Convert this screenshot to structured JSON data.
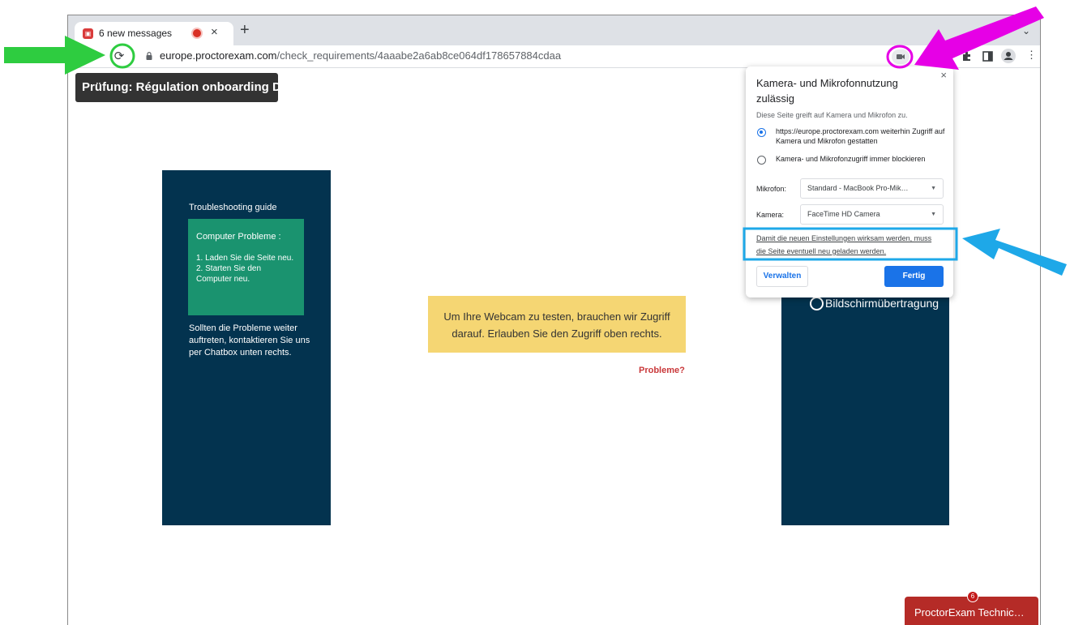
{
  "browser": {
    "tab": {
      "title": "6 new messages",
      "close_glyph": "×"
    },
    "new_tab_glyph": "+",
    "chevron_glyph": "⌄",
    "reload_glyph": "⟳",
    "url_host": "europe.proctorexam.com",
    "url_path": "/check_requirements/4aaabe2a6ab8ce064df178657884cdaa",
    "toolbar_icons": [
      "camera-in-use-icon",
      "extensions-icon",
      "side-panel-icon",
      "profile-icon",
      "menu-icon"
    ],
    "menu_glyph": "⋮"
  },
  "page": {
    "exam_title": "Prüfung: Régulation onboarding DE",
    "troubleshooting": {
      "heading": "Troubleshooting guide",
      "box_title": "Computer Probleme :",
      "box_text": "1. Laden Sie die Seite neu.\n2. Starten Sie den Computer neu.",
      "body": "Sollten die Probleme weiter auftreten, kontaktieren Sie uns per Chatbox unten rechts."
    },
    "webcam_notice": "Um Ihre Webcam zu testen, brauchen wir Zugriff darauf. Erlauben Sie den Zugriff oben rechts.",
    "problems_link": "Probleme?",
    "screen_share_label": "Bildschirmübertragung",
    "chat": {
      "label": "ProctorExam Technic…",
      "badge": "6"
    }
  },
  "popup": {
    "close_glyph": "×",
    "title": "Kamera- und Mikrofonnutzung zulässig",
    "description": "Diese Seite greift auf Kamera und Mikrofon zu.",
    "option_allow": "https://europe.proctorexam.com weiterhin Zugriff auf Kamera und Mikrofon gestatten",
    "option_block": "Kamera- und Mikrofonzugriff immer blockieren",
    "mic_label": "Mikrofon:",
    "mic_value": "Standard - MacBook Pro-Mik…",
    "cam_label": "Kamera:",
    "cam_value": "FaceTime HD Camera",
    "reload_notice": "Damit die neuen Einstellungen wirksam werden, muss die Seite eventuell neu geladen werden.",
    "manage_button": "Verwalten",
    "done_button": "Fertig",
    "caret_glyph": "▼",
    "selected_option": "allow"
  },
  "colors": {
    "panel_navy": "#03334f",
    "green_box": "#1a936f",
    "yellow_box": "#f5d673",
    "problems_red": "#c9383a",
    "chat_red": "#b52b27",
    "primary_blue": "#1a73e8",
    "annotation_green": "#2ecc40",
    "annotation_magenta": "#e600e6",
    "annotation_cyan": "#1ea8e8"
  }
}
